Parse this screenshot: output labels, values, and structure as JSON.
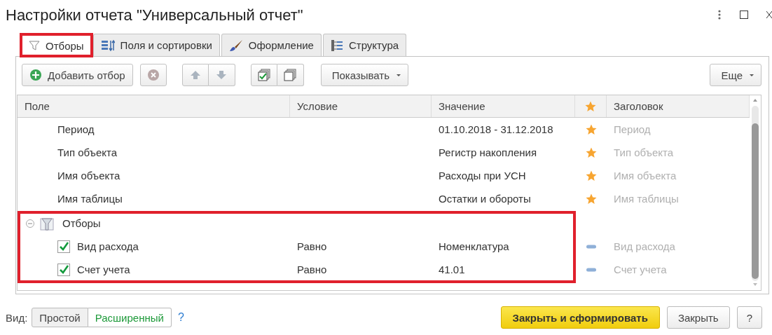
{
  "window": {
    "title": "Настройки отчета \"Универсальный отчет\""
  },
  "tabs": [
    {
      "label": "Отборы",
      "kind": "funnel",
      "selected": true,
      "highlighted": true
    },
    {
      "label": "Поля и сортировки",
      "kind": "fields",
      "selected": false,
      "highlighted": false
    },
    {
      "label": "Оформление",
      "kind": "brush",
      "selected": false,
      "highlighted": false
    },
    {
      "label": "Структура",
      "kind": "tree",
      "selected": false,
      "highlighted": false
    }
  ],
  "toolbar": {
    "add_button": "Добавить отбор",
    "show_button": "Показывать",
    "more_button": "Еще"
  },
  "table": {
    "columns": [
      "Поле",
      "Условие",
      "Значение",
      "Заголовок"
    ],
    "rows": [
      {
        "kind": "field",
        "field": "Период",
        "value": "01.10.2018 - 31.12.2018",
        "quick": true,
        "title": "Период"
      },
      {
        "kind": "field",
        "field": "Тип объекта",
        "value": "Регистр накопления",
        "quick": true,
        "title": "Тип объекта"
      },
      {
        "kind": "field",
        "field": "Имя объекта",
        "value": "Расходы при УСН",
        "quick": true,
        "title": "Имя объекта"
      },
      {
        "kind": "field",
        "field": "Имя таблицы",
        "value": "Остатки и обороты",
        "quick": true,
        "title": "Имя таблицы"
      },
      {
        "kind": "group",
        "field": "Отборы",
        "expanded": true,
        "highlighted": true,
        "children": [
          {
            "kind": "filter",
            "checked": true,
            "field": "Вид расхода",
            "condition": "Равно",
            "value": "Номенклатура",
            "quick": false,
            "title": "Вид расхода"
          },
          {
            "kind": "filter",
            "checked": true,
            "field": "Счет учета",
            "condition": "Равно",
            "value": "41.01",
            "quick": false,
            "title": "Счет учета"
          }
        ]
      }
    ]
  },
  "footer": {
    "view_label": "Вид:",
    "view_options": [
      {
        "label": "Простой",
        "selected": false
      },
      {
        "label": "Расширенный",
        "selected": true
      }
    ],
    "help_link": "?",
    "buttons": [
      {
        "label": "Закрыть и сформировать",
        "kind": "primary"
      },
      {
        "label": "Закрыть",
        "kind": "normal"
      },
      {
        "label": "?",
        "kind": "normal"
      }
    ]
  }
}
